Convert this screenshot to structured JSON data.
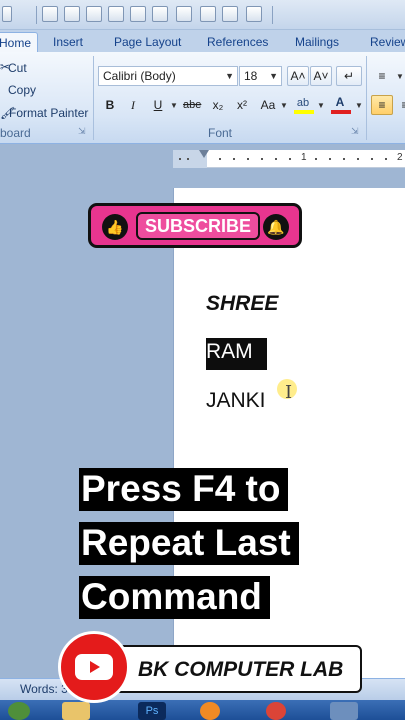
{
  "tabs": [
    "Home",
    "Insert",
    "Page Layout",
    "References",
    "Mailings",
    "Review"
  ],
  "clipboard": {
    "cut_label": "Cut",
    "copy_label": "Copy",
    "format_painter_label": "Format Painter",
    "group_label": "board"
  },
  "font": {
    "name": "Calibri (Body)",
    "size": "18",
    "group_label": "Font",
    "bold": "B",
    "italic": "I",
    "underline": "U",
    "strike": "abe",
    "subscript": "x₂",
    "superscript": "x²",
    "change_case": "Aa",
    "grow": "A˄",
    "shrink": "A˅",
    "highlight_color": "#ffff00",
    "font_color": "#e02020"
  },
  "ruler": {
    "marks": [
      "1",
      "2"
    ]
  },
  "document": {
    "lines": [
      "SHREE",
      "RAM",
      "JANKI"
    ]
  },
  "subscribe": {
    "label": "SUBSCRIBE"
  },
  "caption": {
    "lines": [
      "Press F4 to",
      "Repeat Last",
      "Command"
    ]
  },
  "status": {
    "text": "Words: 3"
  },
  "channel": {
    "name": "BK COMPUTER LAB"
  }
}
